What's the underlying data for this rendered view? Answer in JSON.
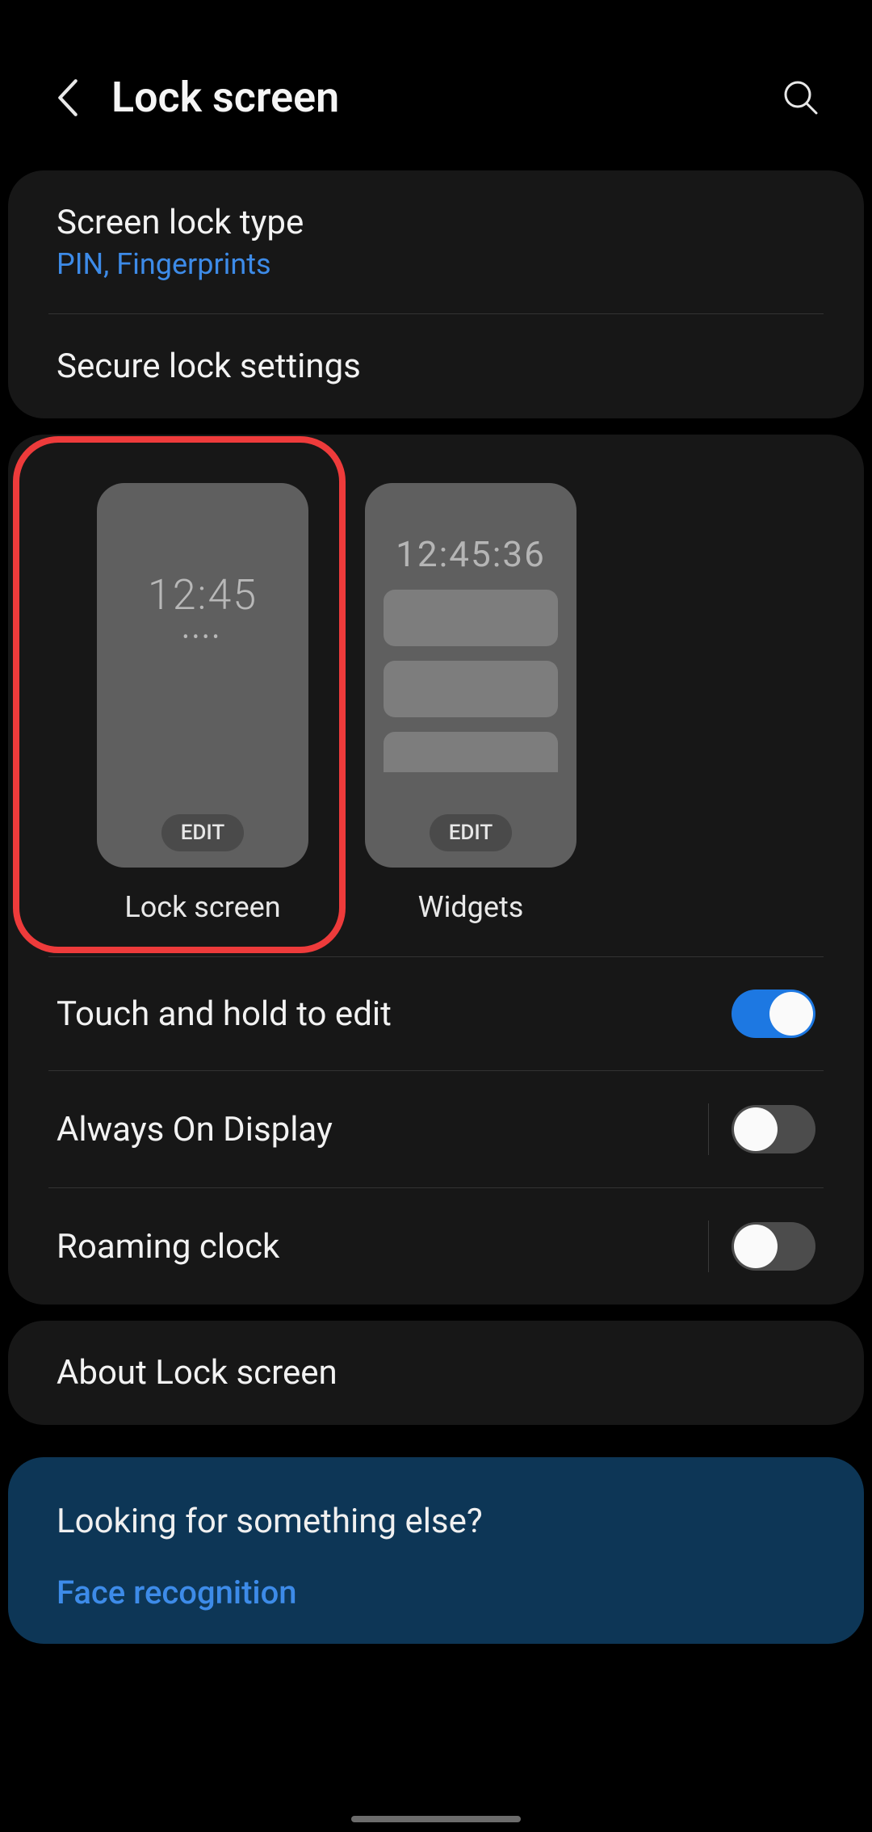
{
  "header": {
    "title": "Lock screen"
  },
  "section1": {
    "lock_type": {
      "title": "Screen lock type",
      "sub": "PIN, Fingerprints"
    },
    "secure": {
      "title": "Secure lock settings"
    }
  },
  "previews": {
    "lockscreen": {
      "clock": "12:45",
      "edit": "EDIT",
      "label": "Lock screen"
    },
    "widgets": {
      "clock": "12:45:36",
      "edit": "EDIT",
      "label": "Widgets"
    }
  },
  "toggles": {
    "touch_hold": {
      "title": "Touch and hold to edit",
      "on": true
    },
    "aod": {
      "title": "Always On Display",
      "on": false
    },
    "roaming": {
      "title": "Roaming clock",
      "on": false
    }
  },
  "about": {
    "title": "About Lock screen"
  },
  "looking": {
    "title": "Looking for something else?",
    "link1": "Face recognition"
  },
  "colors": {
    "accent": "#3d8be8",
    "highlight": "#ee3b3b"
  }
}
